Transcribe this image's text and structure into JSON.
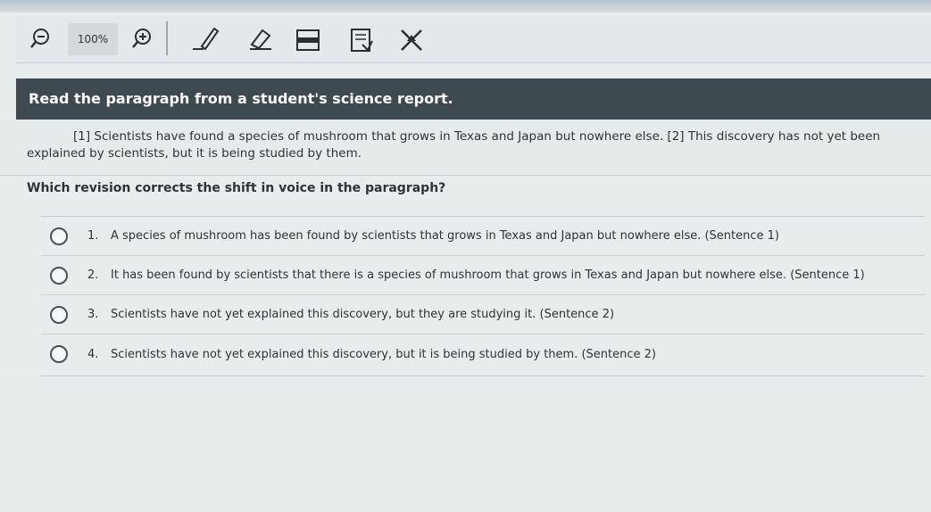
{
  "toolbar": {
    "zoom_level": "100%",
    "icons": [
      "zoom-out-icon",
      "zoom-in-icon",
      "pen-icon",
      "eraser-icon",
      "highlighter-icon",
      "notepad-icon",
      "answer-eliminator-icon"
    ]
  },
  "passage": {
    "header": "Read the paragraph from a student's science report.",
    "text": "[1] Scientists have found a species of mushroom that grows in Texas and Japan but nowhere else. [2] This discovery has not yet been explained by scientists, but it is being studied by them."
  },
  "question": {
    "prompt": "Which revision corrects the shift in voice in the paragraph?",
    "answers": [
      {
        "num": "1.",
        "text": "A species of mushroom has been found by scientists that grows in Texas and Japan but nowhere else. (Sentence 1)"
      },
      {
        "num": "2.",
        "text": "It has been found by scientists that there is a species of mushroom that grows in Texas and Japan but nowhere else. (Sentence 1)"
      },
      {
        "num": "3.",
        "text": "Scientists have not yet explained this discovery, but they are studying it. (Sentence 2)"
      },
      {
        "num": "4.",
        "text": "Scientists have not yet explained this discovery, but it is being studied by them. (Sentence 2)"
      }
    ]
  },
  "colors": {
    "header_bg": "#3f4950",
    "page_bg": "#e7ecec"
  }
}
